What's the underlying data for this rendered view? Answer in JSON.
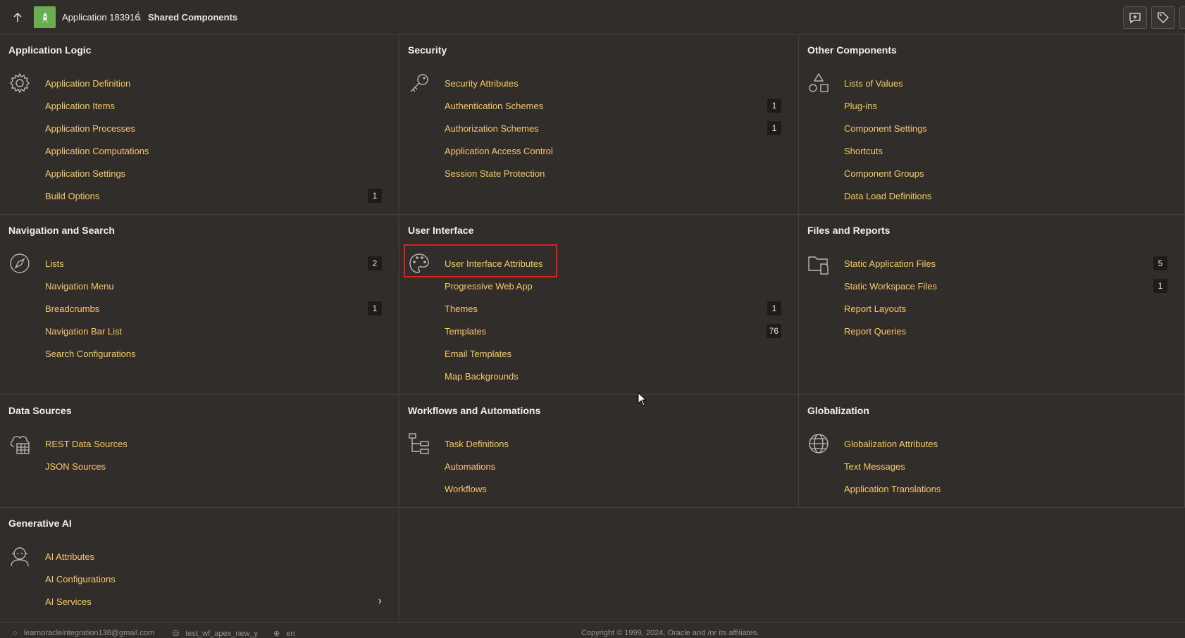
{
  "header": {
    "up_label": "↑",
    "app_name": "Application 183916",
    "separator": "\\",
    "current": "Shared Components"
  },
  "colors": {
    "accent": "#f7c86a",
    "background": "#312d2a",
    "highlight": "#e0201c",
    "app_icon": "#6aae52"
  },
  "cards": [
    {
      "id": "application-logic",
      "title": "Application Logic",
      "icon": "gear-icon",
      "items": [
        {
          "label": "Application Definition"
        },
        {
          "label": "Application Items"
        },
        {
          "label": "Application Processes"
        },
        {
          "label": "Application Computations"
        },
        {
          "label": "Application Settings"
        },
        {
          "label": "Build Options",
          "badge": "1"
        }
      ]
    },
    {
      "id": "security",
      "title": "Security",
      "icon": "key-icon",
      "items": [
        {
          "label": "Security Attributes"
        },
        {
          "label": "Authentication Schemes",
          "badge": "1"
        },
        {
          "label": "Authorization Schemes",
          "badge": "1"
        },
        {
          "label": "Application Access Control"
        },
        {
          "label": "Session State Protection"
        }
      ]
    },
    {
      "id": "other-components",
      "title": "Other Components",
      "icon": "shapes-icon",
      "items": [
        {
          "label": "Lists of Values"
        },
        {
          "label": "Plug-ins"
        },
        {
          "label": "Component Settings"
        },
        {
          "label": "Shortcuts"
        },
        {
          "label": "Component Groups"
        },
        {
          "label": "Data Load Definitions"
        }
      ]
    },
    {
      "id": "navigation-and-search",
      "title": "Navigation and Search",
      "icon": "compass-icon",
      "items": [
        {
          "label": "Lists",
          "badge": "2"
        },
        {
          "label": "Navigation Menu"
        },
        {
          "label": "Breadcrumbs",
          "badge": "1"
        },
        {
          "label": "Navigation Bar List"
        },
        {
          "label": "Search Configurations"
        }
      ]
    },
    {
      "id": "user-interface",
      "title": "User Interface",
      "icon": "palette-icon",
      "items": [
        {
          "label": "User Interface Attributes"
        },
        {
          "label": "Progressive Web App"
        },
        {
          "label": "Themes",
          "badge": "1"
        },
        {
          "label": "Templates",
          "badge": "76"
        },
        {
          "label": "Email Templates"
        },
        {
          "label": "Map Backgrounds"
        }
      ]
    },
    {
      "id": "files-and-reports",
      "title": "Files and Reports",
      "icon": "folder-file-icon",
      "items": [
        {
          "label": "Static Application Files",
          "badge": "5"
        },
        {
          "label": "Static Workspace Files",
          "badge": "1"
        },
        {
          "label": "Report Layouts"
        },
        {
          "label": "Report Queries"
        }
      ]
    },
    {
      "id": "data-sources",
      "title": "Data Sources",
      "icon": "cloud-grid-icon",
      "items": [
        {
          "label": "REST Data Sources"
        },
        {
          "label": "JSON Sources"
        }
      ]
    },
    {
      "id": "workflows-and-automations",
      "title": "Workflows and Automations",
      "icon": "workflow-tree-icon",
      "items": [
        {
          "label": "Task Definitions"
        },
        {
          "label": "Automations"
        },
        {
          "label": "Workflows"
        }
      ]
    },
    {
      "id": "globalization",
      "title": "Globalization",
      "icon": "globe-icon",
      "items": [
        {
          "label": "Globalization Attributes"
        },
        {
          "label": "Text Messages"
        },
        {
          "label": "Application Translations"
        }
      ]
    },
    {
      "id": "generative-ai",
      "title": "Generative AI",
      "icon": "robot-icon",
      "items": [
        {
          "label": "AI Attributes"
        },
        {
          "label": "AI Configurations"
        },
        {
          "label": "AI Services",
          "chevron": true
        }
      ]
    }
  ],
  "footer": {
    "user": "learnoracleintegration138@gmail.com",
    "schema": "test_wf_apex_new_y",
    "language": "en",
    "copyright": "Copyright © 1999, 2024, Oracle and /or its affiliates."
  }
}
